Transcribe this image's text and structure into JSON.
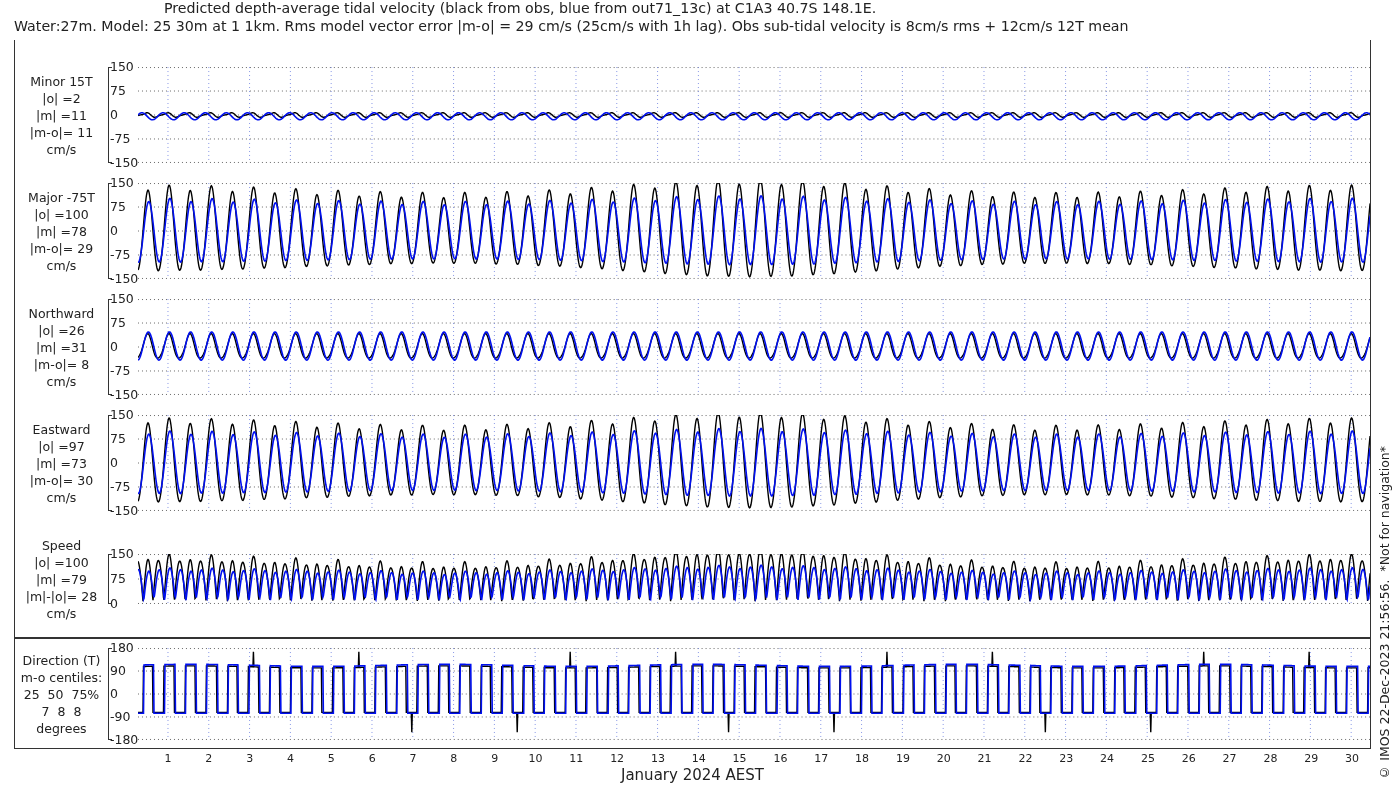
{
  "title_lines": [
    "Predicted depth-average tidal velocity (black from obs, blue from out71_13c) at C1A3 40.7S 148.1E.",
    "Water:27m. Model: 25 30m at 1 1km. Rms model vector error |m-o| = 29 cm/s (25cm/s with 1h lag). Obs sub-tidal velocity is 8cm/s rms + 12cm/s 12T mean"
  ],
  "upper_box": {
    "panels": [
      {
        "kind": "minor",
        "label_lines": [
          "Minor 15T",
          "|o| =2",
          "|m| =11",
          "|m-o|= 11",
          "cm/s"
        ],
        "yticks": [
          "150",
          "75",
          "0",
          "-75",
          "-150"
        ]
      },
      {
        "kind": "major",
        "label_lines": [
          "Major -75T",
          "|o| =100",
          "|m| =78",
          "|m-o|= 29",
          "cm/s"
        ],
        "yticks": [
          "150",
          "75",
          "0",
          "-75",
          "-150"
        ]
      },
      {
        "kind": "northward",
        "label_lines": [
          "Northward",
          "|o| =26",
          "|m| =31",
          "|m-o|= 8",
          "cm/s"
        ],
        "yticks": [
          "150",
          "75",
          "0",
          "-75",
          "-150"
        ]
      },
      {
        "kind": "eastward",
        "label_lines": [
          "Eastward",
          "|o| =97",
          "|m| =73",
          "|m-o|= 30",
          "cm/s"
        ],
        "yticks": [
          "150",
          "75",
          "0",
          "-75",
          "-150"
        ]
      },
      {
        "kind": "speed",
        "label_lines": [
          "Speed",
          "|o| =100",
          "|m| =79",
          "|m|-|o|= 28",
          "cm/s"
        ],
        "yticks": [
          "150",
          "75",
          "0"
        ]
      }
    ]
  },
  "lower_box": {
    "panels": [
      {
        "kind": "direction",
        "label_lines": [
          "Direction (T)",
          "m-o centiles:",
          "25  50  75%",
          "7  8  8",
          "degrees"
        ],
        "yticks": [
          "180",
          "90",
          "0",
          "-90",
          "-180"
        ]
      }
    ]
  },
  "x_axis": {
    "ticks": [
      "1",
      "2",
      "3",
      "4",
      "5",
      "6",
      "7",
      "8",
      "9",
      "10",
      "11",
      "12",
      "13",
      "14",
      "15",
      "16",
      "17",
      "18",
      "19",
      "20",
      "21",
      "22",
      "23",
      "24",
      "25",
      "26",
      "27",
      "28",
      "29",
      "30"
    ],
    "label": "January 2024 AEST"
  },
  "credit": "© IMOS 22-Dec-2023 21:56:56.  *Not for navigation*"
}
